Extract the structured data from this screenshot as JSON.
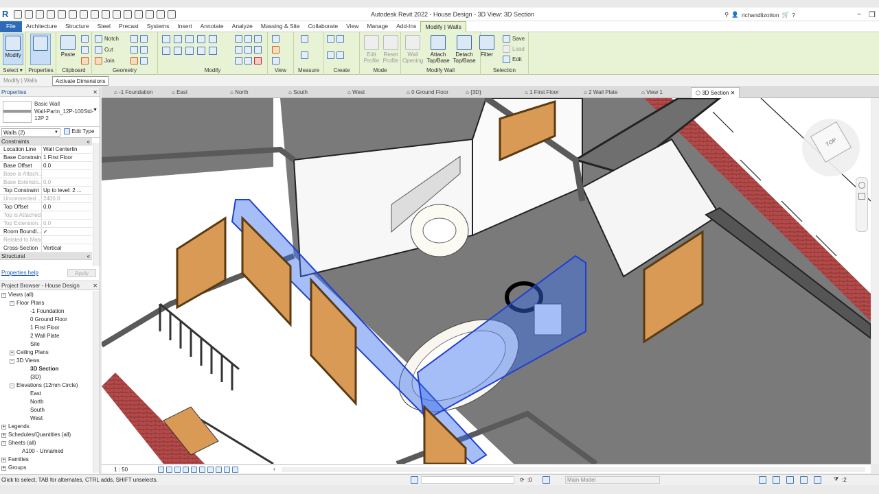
{
  "app": {
    "title": "Autodesk Revit 2022 - House Design - 3D View: 3D Section",
    "logo": "R",
    "user": "richandlizotton",
    "help": "?"
  },
  "ribbon_tabs": [
    "File",
    "Architecture",
    "Structure",
    "Steel",
    "Precast",
    "Systems",
    "Insert",
    "Annotate",
    "Analyze",
    "Massing & Site",
    "Collaborate",
    "View",
    "Manage",
    "Add-Ins",
    "Modify | Walls"
  ],
  "ribbon": {
    "modify_label": "Modify",
    "select_label": "Select ▾",
    "properties_label": "Properties",
    "paste_label": "Paste",
    "clipboard_label": "Clipboard",
    "notch_label": "Notch",
    "cut_label": "Cut",
    "join_label": "Join",
    "geometry_label": "Geometry",
    "modify_panel_label": "Modify",
    "view_label": "View",
    "measure_label": "Measure",
    "create_label": "Create",
    "edit_profile": "Edit Profile",
    "reset_profile": "Reset Profile",
    "mode_label": "Mode",
    "wall_opening": "Wall Opening",
    "attach_label": "Attach Top/Base",
    "detach_label": "Detach Top/Base",
    "modify_wall_label": "Modify Wall",
    "filter_label": "Filter",
    "selection_label": "Selection",
    "save_label": "Save",
    "load_label": "Load",
    "edit_label": "Edit"
  },
  "optionbar": {
    "label": "Modify | Walls",
    "activate_dimensions": "Activate Dimensions"
  },
  "properties": {
    "title": "Properties",
    "type_name": "Basic Wall\nWall-Partn_12P-100Std-12P 2",
    "instance": "Walls (2)",
    "edit_type": "Edit Type",
    "section_constraints": "Constraints",
    "rows": [
      {
        "k": "Location Line",
        "v": "Wall Centerlin",
        "dim": false
      },
      {
        "k": "Base Constraint",
        "v": "1 First Floor",
        "dim": false
      },
      {
        "k": "Base Offset",
        "v": "0.0",
        "dim": false
      },
      {
        "k": "Base is Attach...",
        "v": "",
        "dim": true
      },
      {
        "k": "Base Extensio...",
        "v": "0.0",
        "dim": true
      },
      {
        "k": "Top Constraint",
        "v": "Up to level: 2 ...",
        "dim": false
      },
      {
        "k": "Unconnected ...",
        "v": "2400.0",
        "dim": true
      },
      {
        "k": "Top Offset",
        "v": "0.0",
        "dim": false
      },
      {
        "k": "Top is Attached",
        "v": "",
        "dim": true
      },
      {
        "k": "Top Extension...",
        "v": "0.0",
        "dim": true
      },
      {
        "k": "Room Boundi...",
        "v": "✓",
        "dim": false
      },
      {
        "k": "Related to Mass",
        "v": "",
        "dim": true
      },
      {
        "k": "Cross-Section",
        "v": "Vertical",
        "dim": false
      }
    ],
    "section_structural": "Structural",
    "help_link": "Properties help",
    "apply": "Apply"
  },
  "browser": {
    "title": "Project Browser - House Design",
    "items": [
      {
        "label": "Views (all)",
        "indent": 0,
        "exp": "-",
        "bold": false
      },
      {
        "label": "Floor Plans",
        "indent": 1,
        "exp": "-",
        "bold": false
      },
      {
        "label": "-1 Foundation",
        "indent": 3,
        "exp": "",
        "bold": false
      },
      {
        "label": "0 Ground Floor",
        "indent": 3,
        "exp": "",
        "bold": false
      },
      {
        "label": "1 First Floor",
        "indent": 3,
        "exp": "",
        "bold": false
      },
      {
        "label": "2 Wall Plate",
        "indent": 3,
        "exp": "",
        "bold": false
      },
      {
        "label": "Site",
        "indent": 3,
        "exp": "",
        "bold": false
      },
      {
        "label": "Ceiling Plans",
        "indent": 1,
        "exp": "+",
        "bold": false
      },
      {
        "label": "3D Views",
        "indent": 1,
        "exp": "-",
        "bold": false
      },
      {
        "label": "3D Section",
        "indent": 3,
        "exp": "",
        "bold": true
      },
      {
        "label": "{3D}",
        "indent": 3,
        "exp": "",
        "bold": false
      },
      {
        "label": "Elevations (12mm Circle)",
        "indent": 1,
        "exp": "-",
        "bold": false
      },
      {
        "label": "East",
        "indent": 3,
        "exp": "",
        "bold": false
      },
      {
        "label": "North",
        "indent": 3,
        "exp": "",
        "bold": false
      },
      {
        "label": "South",
        "indent": 3,
        "exp": "",
        "bold": false
      },
      {
        "label": "West",
        "indent": 3,
        "exp": "",
        "bold": false
      },
      {
        "label": "Legends",
        "indent": 0,
        "exp": "+",
        "bold": false
      },
      {
        "label": "Schedules/Quantities (all)",
        "indent": 0,
        "exp": "+",
        "bold": false
      },
      {
        "label": "Sheets (all)",
        "indent": 0,
        "exp": "-",
        "bold": false
      },
      {
        "label": "A100 - Unnamed",
        "indent": 2,
        "exp": "",
        "bold": false
      },
      {
        "label": "Families",
        "indent": 0,
        "exp": "+",
        "bold": false
      },
      {
        "label": "Groups",
        "indent": 0,
        "exp": "+",
        "bold": false
      }
    ]
  },
  "view_tabs": [
    "-1 Foundation",
    "East",
    "North",
    "South",
    "West",
    "0 Ground Floor",
    "{3D}",
    "1 First Floor",
    "2 Wall Plate",
    "View 1",
    "3D Section"
  ],
  "view": {
    "scale": "1 : 50",
    "viewcube_label": "TOP"
  },
  "status": {
    "text": "Click to select, TAB for alternates, CTRL adds, SHIFT unselects.",
    "coord": ":0",
    "model": "Main Model",
    "filter_count": ":2"
  },
  "colors": {
    "accent": "#2d6bb7",
    "ribbon_bg": "#e8f2d4",
    "selection": "#3a6ff0",
    "door": "#d99a55",
    "brick": "#b34a4a"
  }
}
